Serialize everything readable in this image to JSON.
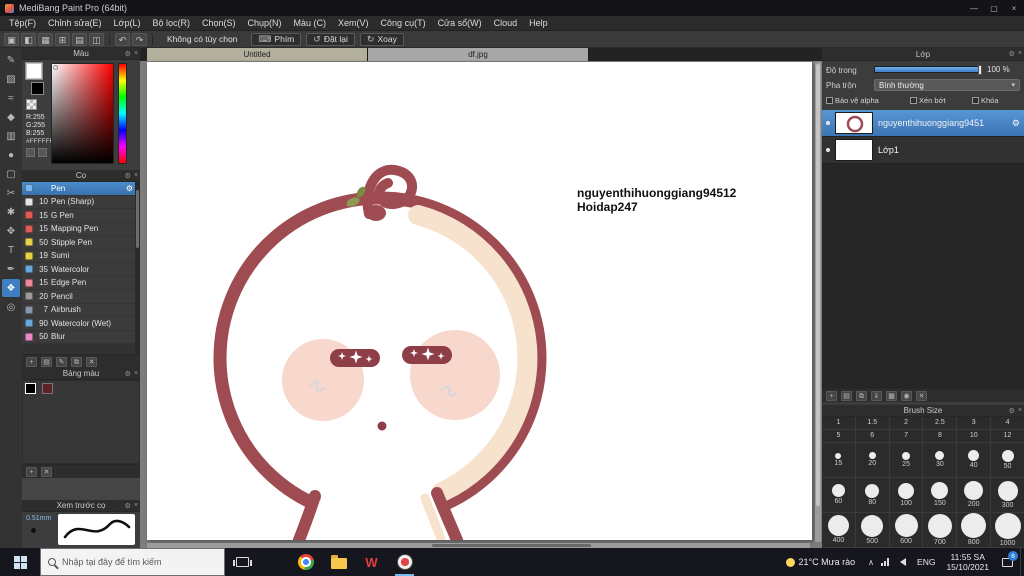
{
  "titlebar": {
    "title": "MediBang Paint Pro (64bit)"
  },
  "icons": {
    "minimize": "—",
    "maximize": "▢",
    "close": "×",
    "stamp": "▣",
    "bubble": "◧",
    "grid": "▦",
    "cells": "⊞",
    "rows": "▤",
    "mirror": "◫",
    "undo": "↶",
    "redo": "↷",
    "keyboard": "⌨",
    "reset": "↺",
    "rotate": "↻",
    "gear": "⚙",
    "x": "×",
    "menu": "▾",
    "add": "+",
    "dup": "⧉",
    "fold": "▤",
    "down": "⇓",
    "cam": "◉",
    "trash": "✕",
    "pen": "✎",
    "chevron_up": "∧"
  },
  "menubar": {
    "items": [
      "Tệp(F)",
      "Chỉnh sửa(E)",
      "Lớp(L)",
      "Bộ lọc(R)",
      "Chọn(S)",
      "Chụp(N)",
      "Màu (C)",
      "Xem(V)",
      "Công cụ(T)",
      "Cửa sổ(W)",
      "Cloud",
      "Help"
    ]
  },
  "toolbar": {
    "no_option": "Không có tùy chọn",
    "key_btn": "Phím",
    "reset_btn": "Đặt lại",
    "rotate_btn": "Xoay"
  },
  "tools": [
    {
      "name": "pen-tool",
      "glyph": "✎"
    },
    {
      "name": "eraser-tool",
      "glyph": "▨"
    },
    {
      "name": "smudge-tool",
      "glyph": "≈"
    },
    {
      "name": "fill-tool",
      "glyph": "◆"
    },
    {
      "name": "gradient-tool",
      "glyph": "▥"
    },
    {
      "name": "bucket-tool",
      "glyph": "●"
    },
    {
      "name": "select-tool",
      "glyph": "▢"
    },
    {
      "name": "lasso-tool",
      "glyph": "✂"
    },
    {
      "name": "wand-tool",
      "glyph": "✱"
    },
    {
      "name": "move-tool",
      "glyph": "✥"
    },
    {
      "name": "text-tool",
      "glyph": "T"
    },
    {
      "name": "eyedropper-tool",
      "glyph": "✒"
    },
    {
      "name": "hand-tool",
      "glyph": "❖"
    },
    {
      "name": "zoom-tool",
      "glyph": "◎"
    }
  ],
  "color_panel": {
    "title": "Màu",
    "r": "R:255",
    "g": "G:255",
    "b": "B:255",
    "hex": "#FFFFFF"
  },
  "brush_panel": {
    "title": "Cọ",
    "brushes": [
      {
        "size": "",
        "name": "Pen",
        "color": "#79b8f0",
        "selected": true
      },
      {
        "size": "10",
        "name": "Pen (Sharp)",
        "color": "#e6e6e6"
      },
      {
        "size": "15",
        "name": "G Pen",
        "color": "#e05a5a"
      },
      {
        "size": "15",
        "name": "Mapping Pen",
        "color": "#e05a5a"
      },
      {
        "size": "50",
        "name": "Stipple Pen",
        "color": "#e8d44a"
      },
      {
        "size": "19",
        "name": "Sumi",
        "color": "#e8d44a"
      },
      {
        "size": "35",
        "name": "Watercolor",
        "color": "#66aadd"
      },
      {
        "size": "15",
        "name": "Edge Pen",
        "color": "#ee8899"
      },
      {
        "size": "20",
        "name": "Pencil",
        "color": "#9a9a9a"
      },
      {
        "size": "7",
        "name": "Airbrush",
        "color": "#8899aa"
      },
      {
        "size": "90",
        "name": "Watercolor (Wet)",
        "color": "#66aadd"
      },
      {
        "size": "50",
        "name": "Blur",
        "color": "#ee88cc"
      }
    ]
  },
  "palette_panel": {
    "title": "Bảng màu",
    "colors": [
      "#000000",
      "#5d2228"
    ]
  },
  "preview_panel": {
    "title": "Xem trước cọ",
    "stroke_width": "0.51mm"
  },
  "doc_tabs": {
    "tab1": "Untitled",
    "tab2": "df.jpg"
  },
  "canvas": {
    "watermark_line1": "nguyenthihuonggiang94512",
    "watermark_line2": "Hoidap247"
  },
  "artwork": {
    "outline": "#9e4b52",
    "shade": "#f6e2cd",
    "blush": "#f8d7cc",
    "leaf": "#8d9a50"
  },
  "layer_panel": {
    "title": "Lớp",
    "opacity_label": "Độ trong",
    "opacity_value": "100 %",
    "blend_label": "Pha trộn",
    "blend_value": "Bình thường",
    "alpha_label": "Bảo vệ alpha",
    "clip_label": "Xén bớt",
    "lock_label": "Khóa",
    "layer1": "nguyenthihuonggiang9451",
    "layer2": "Lớp1"
  },
  "brush_size_panel": {
    "title": "Brush Size",
    "rows": [
      [
        "1",
        "1.5",
        "2",
        "2.5",
        "3",
        "4"
      ],
      [
        "5",
        "6",
        "7",
        "8",
        "10",
        "12"
      ],
      [
        "15",
        "20",
        "25",
        "30",
        "40",
        "50"
      ],
      [
        "60",
        "80",
        "100",
        "150",
        "200",
        "300"
      ],
      [
        "400",
        "500",
        "600",
        "700",
        "800",
        "1000"
      ]
    ]
  },
  "taskbar": {
    "search_placeholder": "Nhập tại đây để tìm kiếm",
    "weather": "21°C Mưa rào",
    "lang": "ENG",
    "time": "11:55 SA",
    "date": "15/10/2021",
    "badge": "6"
  }
}
